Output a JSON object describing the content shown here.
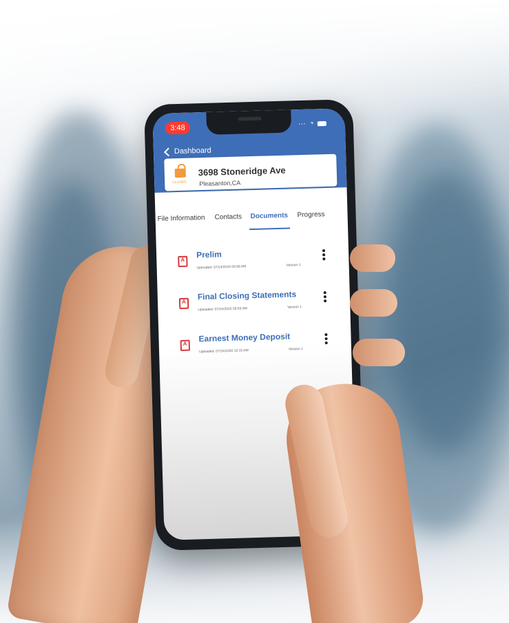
{
  "status_bar": {
    "time": "3:48"
  },
  "navigation": {
    "back_label": "Dashboard"
  },
  "property": {
    "status_label": "CLOSED",
    "address": "3698 Stoneridge Ave",
    "city": "Pleasanton,CA"
  },
  "tabs": [
    {
      "label": "File Information"
    },
    {
      "label": "Contacts"
    },
    {
      "label": "Documents",
      "active": true
    },
    {
      "label": "Progress"
    }
  ],
  "documents": [
    {
      "title": "Prelim",
      "uploaded": "Uploaded: 07/24/2020 09:58 AM",
      "version": "Version 1"
    },
    {
      "title": "Final Closing Statements",
      "uploaded": "Uploaded: 07/24/2020 09:59 AM",
      "version": "Version 1"
    },
    {
      "title": "Earnest Money Deposit",
      "uploaded": "Uploaded: 07/24/2020 10:15 AM",
      "version": "Version 1"
    }
  ],
  "colors": {
    "app_blue": "#3f6eb8",
    "closed_orange": "#f29a3d",
    "pdf_red": "#d63a3a",
    "time_pill_red": "#ff3b30"
  },
  "icons": {
    "back": "chevron-left-icon",
    "status": "lock-icon",
    "document": "pdf-icon",
    "menu": "more-vertical-icon"
  }
}
